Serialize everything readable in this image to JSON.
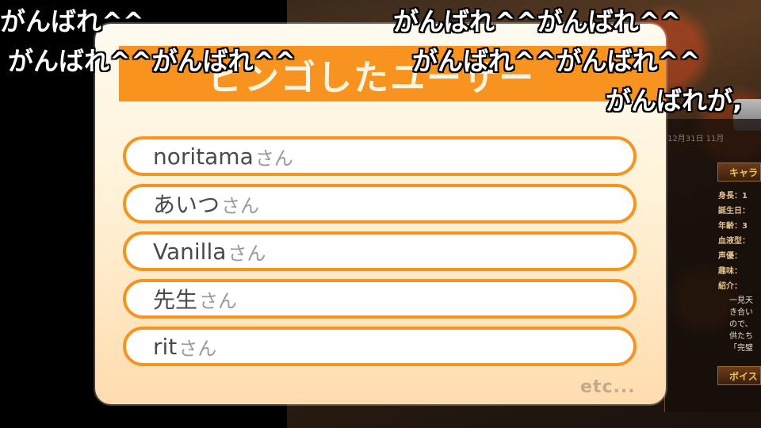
{
  "banner": {
    "title": "ビンゴしたユーザー"
  },
  "users": [
    {
      "name": "noritama",
      "suffix": "さん"
    },
    {
      "name": "あいつ",
      "suffix": "さん"
    },
    {
      "name": "Vanilla",
      "suffix": "さん"
    },
    {
      "name": "先生",
      "suffix": "さん"
    },
    {
      "name": "rit",
      "suffix": "さん"
    }
  ],
  "more_label": "etc...",
  "profile": {
    "date": "12月31日 11月",
    "chara_header": "キャラ",
    "voice_header": "ボイス",
    "stats": [
      "身長：1",
      "誕生日：",
      "年齢：3",
      "血液型：",
      "声優：",
      "趣味：",
      "紹介："
    ],
    "bio": [
      "一見天",
      "き合い",
      "ので、",
      "供たち",
      "「完璧"
    ]
  },
  "comments": [
    "がんばれ^^",
    "がんばれ^^がんばれ^^",
    "がんばれ^^がんばれ^^",
    "がんばれ^^がんばれ^^",
    "がんばれが,"
  ],
  "colors": {
    "accent": "#f7931e",
    "banner_text": "#fff4e0",
    "card_top": "#fffaf0",
    "card_bottom": "#ffdcae"
  }
}
